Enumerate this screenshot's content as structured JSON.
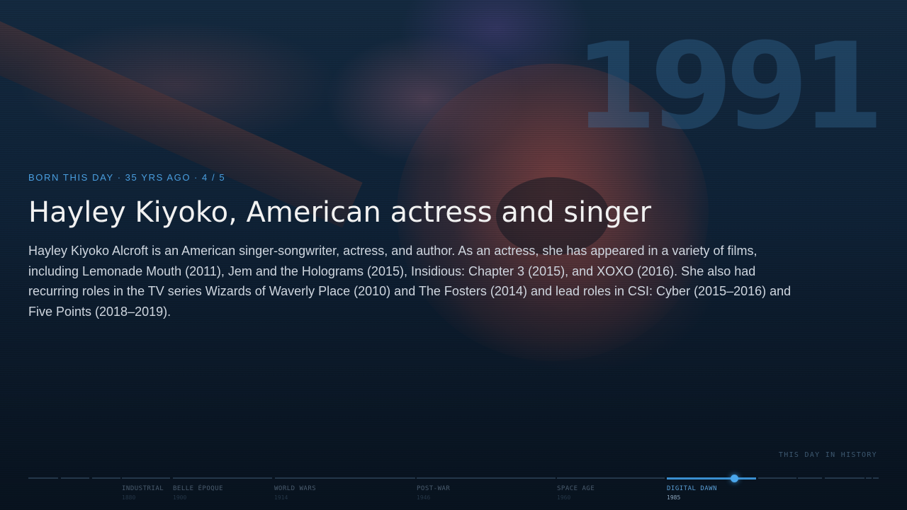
{
  "hero": {
    "year": "1991",
    "eyebrow": {
      "kind": "BORN THIS DAY",
      "age": "35 YRS AGO",
      "position": "4 / 5"
    },
    "title": "Hayley Kiyoko, American actress and singer",
    "description": "Hayley Kiyoko Alcroft is an American singer-songwriter, actress, and author. As an actress, she has appeared in a variety of films, including Lemonade Mouth (2011), Jem and the Holograms (2015), Insidious: Chapter 3 (2015), and XOXO (2016). She also had recurring roles in the TV series Wizards of Waverly Place (2010) and The Fosters (2014) and lead roles in CSI: Cyber (2015–2016) and Five Points (2018–2019)."
  },
  "brand": "THIS DAY IN HISTORY",
  "timeline": {
    "eras": [
      {
        "name": "INDUSTRIAL",
        "year": "1880",
        "active": false
      },
      {
        "name": "BELLE ÉPOQUE",
        "year": "1900",
        "active": false
      },
      {
        "name": "WORLD WARS",
        "year": "1914",
        "active": false
      },
      {
        "name": "POST-WAR",
        "year": "1946",
        "active": false
      },
      {
        "name": "SPACE AGE",
        "year": "1960",
        "active": false
      },
      {
        "name": "DIGITAL DAWN",
        "year": "1985",
        "active": true
      }
    ],
    "current_progress": 0.83,
    "colors": {
      "active": "#4aa6ec",
      "inactive": "#24374a"
    }
  }
}
